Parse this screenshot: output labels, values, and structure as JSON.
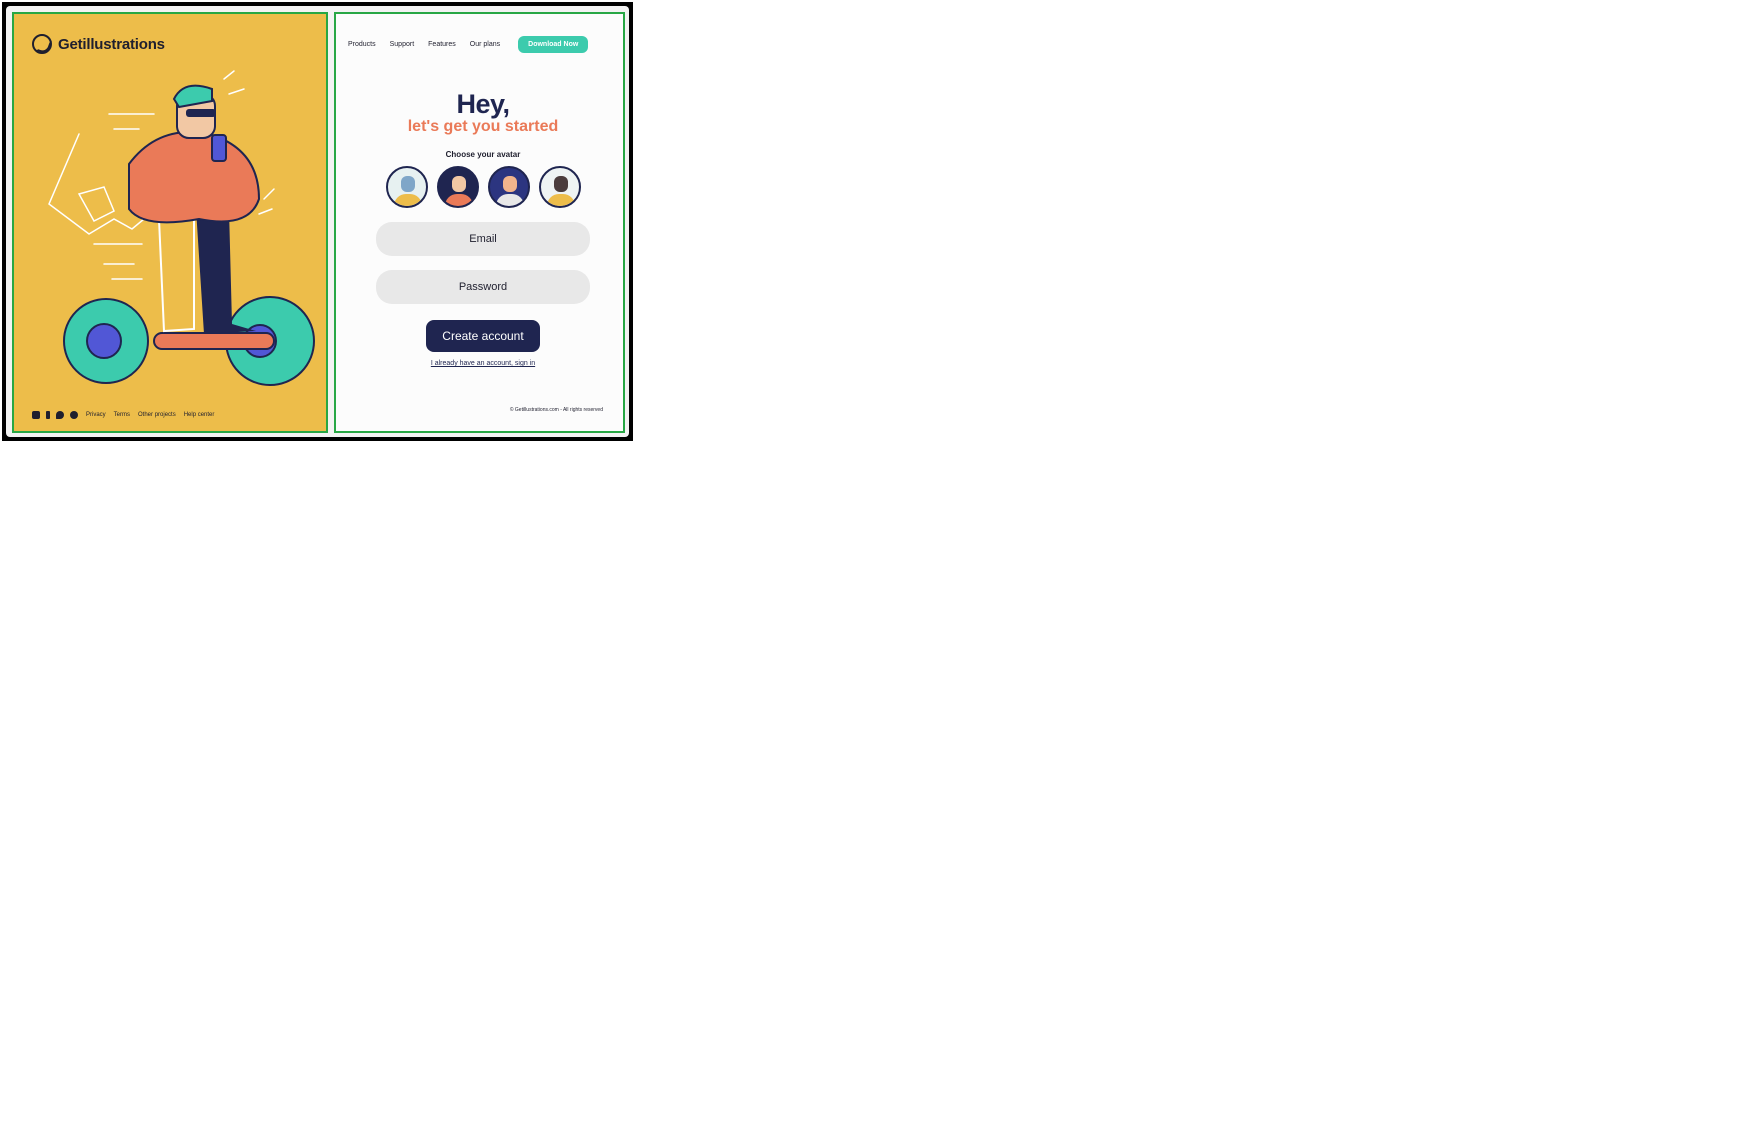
{
  "brand": {
    "name": "Getillustrations"
  },
  "nav": {
    "items": [
      "Products",
      "Support",
      "Features",
      "Our plans"
    ],
    "cta": "Download Now"
  },
  "signup": {
    "title": "Hey,",
    "subtitle": "let's get you started",
    "avatar_label": "Choose your avatar",
    "email_placeholder": "Email",
    "password_placeholder": "Password",
    "create_button": "Create account",
    "signin_link": "I already have an account, sign in"
  },
  "footer": {
    "links": [
      "Privacy",
      "Terms",
      "Other projects",
      "Help center"
    ],
    "social_icons": [
      "instagram-icon",
      "facebook-icon",
      "twitter-icon",
      "dribbble-icon"
    ],
    "copyright": "© Getillustrations.com - All rights reserved"
  },
  "colors": {
    "accent": "#3ccbad",
    "brand_navy": "#1f2550",
    "subtitle": "#ea7a58",
    "left_panel": "#edbd4a"
  }
}
